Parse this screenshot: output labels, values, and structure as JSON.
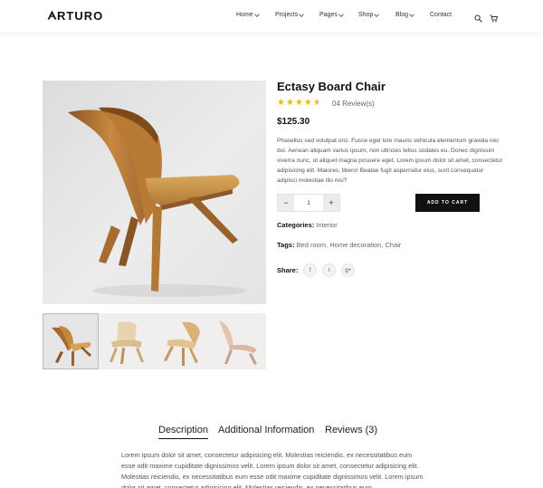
{
  "header": {
    "logo": "RTURO",
    "nav": [
      {
        "label": "Home",
        "has_dropdown": true
      },
      {
        "label": "Projects",
        "has_dropdown": true
      },
      {
        "label": "Pages",
        "has_dropdown": true
      },
      {
        "label": "Shop",
        "has_dropdown": true
      },
      {
        "label": "Blog",
        "has_dropdown": true
      },
      {
        "label": "Contact",
        "has_dropdown": false
      }
    ],
    "icons": [
      "search-icon",
      "cart-icon"
    ]
  },
  "product": {
    "title": "Ectasy Board Chair",
    "rating": 4.5,
    "reviews": "04 Review(s)",
    "price": "$125.30",
    "description": "Phasellus sed volutpat orci. Fusce eget lore mauris vehicula elementum gravida nec dui. Aenean aliquam varius ipsum, non ultricies tellus sodales eu. Donec dignissim viverra nunc, ut aliquet magna posuere eget. Lorem ipsum dolor sit amet, consectetur adipisicing elit. Maiores, libero! Beatae fugit aspernatur eius, sunt consequatur adipisci molestiae illo nisi?",
    "quantity": "1",
    "qty_minus": "−",
    "qty_plus": "+",
    "add_to_cart": "ADD TO CART",
    "categories_label": "Categories:",
    "categories_value": "Interior",
    "tags_label": "Tags:",
    "tags_value": "Bed room,  Home decoration,  Chair",
    "share_label": "Share:",
    "share_icons": [
      "facebook-icon",
      "twitter-icon",
      "google-plus-icon"
    ],
    "share_glyphs": [
      "f",
      "t",
      "g+"
    ]
  },
  "colors": {
    "star": "#f2b800",
    "button_bg": "#111111",
    "wood": "#c8893f"
  },
  "tabs": [
    {
      "label": "Description",
      "active": true
    },
    {
      "label": "Additional Information",
      "active": false
    },
    {
      "label": "Reviews (3)",
      "active": false
    }
  ],
  "body_text": "Lorem ipsum dolor sit amet, consectetur adipisicing elit. Molestias reiciendis, ex necessitatibus eum esse odit maxime cupiditate dignissimos velit. Lorem ipsum dolor sit amet, consectetur adipisicing elit. Molestias reiciendis, ex necessitatibus eum esse odit maxime cupiditate dignissimos velit. Lorem ipsum dolor sit amet, consectetur adipisicing elit. Molestias reiciendis, ex necessitatibus eum"
}
